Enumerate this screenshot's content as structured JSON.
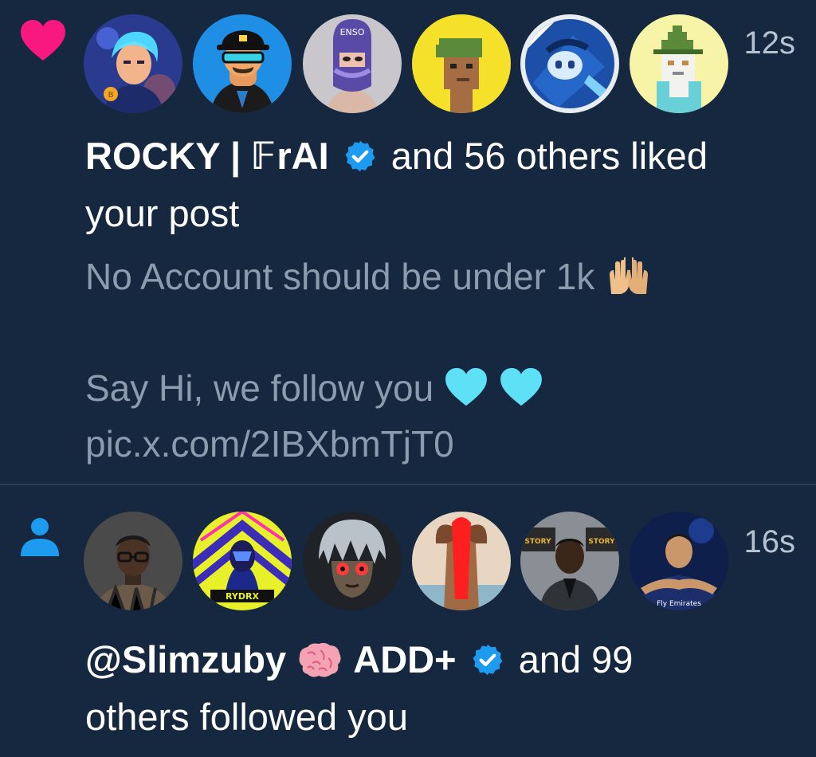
{
  "notifications": [
    {
      "type": "like",
      "icon": "heart-icon",
      "icon_color": "#f91880",
      "time": "12s",
      "avatars": [
        "avatar-anime-boy",
        "avatar-cartoon-man",
        "avatar-ensko-mask",
        "avatar-pixel-punk",
        "avatar-blue-anime",
        "avatar-pixel-wizard"
      ],
      "actor_name": "ROCKY | 𝔽rAI",
      "actor_verified": true,
      "suffix": "and 56 others liked",
      "suffix_line2": "your post",
      "post_lines": [
        "No Account should be under 1k",
        "",
        "Say Hi, we follow you",
        "pic.x.com/2IBXbmTjT0"
      ]
    },
    {
      "type": "follow",
      "icon": "person-icon",
      "icon_color": "#1d9bf0",
      "time": "16s",
      "avatars": [
        "avatar-glasses-man",
        "avatar-rydrx",
        "avatar-anime-grey",
        "avatar-red-hair",
        "avatar-suit-man",
        "avatar-ronaldo"
      ],
      "actor_name": "@Slimzuby",
      "actor2_name": "ADD+",
      "actor2_verified": true,
      "suffix": "and 99",
      "suffix_line2": "others followed you",
      "avatar_labels": {
        "rydrx": "RYDRX",
        "ensko": "ENSO",
        "story": "STORY",
        "jersey": "Fly Emirates"
      }
    }
  ],
  "colors": {
    "background": "#15283f",
    "muted_text": "#8c9bad",
    "verified_blue": "#1d9bf0",
    "divider": "#2b3e55"
  }
}
